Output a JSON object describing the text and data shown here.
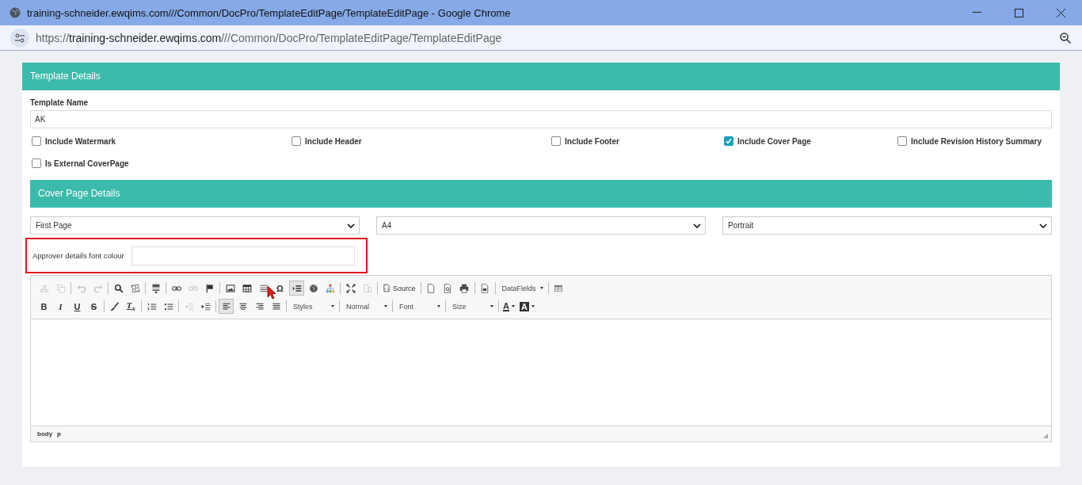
{
  "window": {
    "title": "training-schneider.ewqims.com///Common/DocPro/TemplateEditPage/TemplateEditPage - Google Chrome"
  },
  "address_bar": {
    "scheme": "https://",
    "host": "training-schneider.ewqims.com",
    "path": "///Common/DocPro/TemplateEditPage/TemplateEditPage"
  },
  "template_details": {
    "title": "Template Details",
    "name_label": "Template Name",
    "name_value": "AK",
    "options": [
      {
        "label": "Include Watermark",
        "checked": false
      },
      {
        "label": "Include Header",
        "checked": false
      },
      {
        "label": "Include Footer",
        "checked": false
      },
      {
        "label": "Include Cover Page",
        "checked": true
      },
      {
        "label": "Include Revision History Summary",
        "checked": false
      },
      {
        "label": "Is External CoverPage",
        "checked": false
      }
    ]
  },
  "cover_page_details": {
    "title": "Cover Page Details",
    "dropdowns": [
      {
        "value": "First Page"
      },
      {
        "value": "A4"
      },
      {
        "value": "Portrait"
      }
    ],
    "approver_label": "Approver details font colour"
  },
  "editor": {
    "toolbar_rows": [
      [
        {
          "kind": "icon",
          "disabled": true,
          "active": false
        },
        {
          "kind": "icon",
          "disabled": true,
          "active": false
        },
        {
          "kind": "sep"
        },
        {
          "kind": "icon",
          "disabled": true,
          "active": false
        },
        {
          "kind": "icon",
          "disabled": true,
          "active": false
        },
        {
          "kind": "sep"
        },
        {
          "kind": "icon",
          "disabled": false,
          "active": false
        },
        {
          "kind": "icon",
          "disabled": false,
          "active": false
        },
        {
          "kind": "sep"
        },
        {
          "kind": "icon",
          "disabled": false,
          "active": false
        },
        {
          "kind": "sep"
        },
        {
          "kind": "icon",
          "disabled": false,
          "active": false
        },
        {
          "kind": "icon",
          "disabled": true,
          "active": false
        },
        {
          "kind": "icon",
          "disabled": false,
          "active": false
        },
        {
          "kind": "sep"
        },
        {
          "kind": "icon",
          "disabled": false,
          "active": false
        },
        {
          "kind": "icon",
          "disabled": false,
          "active": false
        },
        {
          "kind": "icon",
          "disabled": false,
          "active": false
        },
        {
          "kind": "glyph",
          "text": "Ω",
          "disabled": false,
          "active": false
        },
        {
          "kind": "icon",
          "disabled": false,
          "active": true
        },
        {
          "kind": "icon",
          "disabled": false,
          "active": false
        },
        {
          "kind": "icon",
          "disabled": false,
          "active": false
        },
        {
          "kind": "sep"
        },
        {
          "kind": "icon",
          "disabled": false,
          "active": false
        },
        {
          "kind": "icon",
          "disabled": true,
          "active": false
        },
        {
          "kind": "sep"
        },
        {
          "kind": "source",
          "text": "Source",
          "disabled": false,
          "active": false
        },
        {
          "kind": "sep"
        },
        {
          "kind": "icon",
          "disabled": false,
          "active": false
        },
        {
          "kind": "icon",
          "disabled": false,
          "active": false
        },
        {
          "kind": "icon",
          "disabled": false,
          "active": false
        },
        {
          "kind": "sep"
        },
        {
          "kind": "icon",
          "disabled": false,
          "active": false
        },
        {
          "kind": "sep"
        },
        {
          "kind": "combo",
          "text": "DataFields"
        },
        {
          "kind": "sep"
        },
        {
          "kind": "icon",
          "disabled": false,
          "active": false
        }
      ],
      [
        {
          "kind": "glyph",
          "text": "B",
          "disabled": false,
          "active": false
        },
        {
          "kind": "glyph",
          "text": "I",
          "disabled": false,
          "active": false
        },
        {
          "kind": "glyph",
          "text": "U",
          "disabled": false,
          "active": false
        },
        {
          "kind": "glyph",
          "text": "S",
          "disabled": false,
          "active": false
        },
        {
          "kind": "sep"
        },
        {
          "kind": "icon",
          "disabled": false,
          "active": false
        },
        {
          "kind": "glyph",
          "text": "T$_{x}$",
          "disabled": false,
          "active": false
        },
        {
          "kind": "sep"
        },
        {
          "kind": "icon",
          "disabled": false,
          "active": false
        },
        {
          "kind": "icon",
          "disabled": false,
          "active": false
        },
        {
          "kind": "sep"
        },
        {
          "kind": "icon",
          "disabled": true,
          "active": false
        },
        {
          "kind": "icon",
          "disabled": false,
          "active": false
        },
        {
          "kind": "sep"
        },
        {
          "kind": "icon",
          "disabled": false,
          "active": true
        },
        {
          "kind": "icon",
          "disabled": false,
          "active": false
        },
        {
          "kind": "icon",
          "disabled": false,
          "active": false
        },
        {
          "kind": "icon",
          "disabled": false,
          "active": false
        },
        {
          "kind": "sep"
        },
        {
          "kind": "combo",
          "text": "Styles"
        },
        {
          "kind": "sep"
        },
        {
          "kind": "combo",
          "text": "Normal"
        },
        {
          "kind": "sep"
        },
        {
          "kind": "combo",
          "text": "Font"
        },
        {
          "kind": "sep"
        },
        {
          "kind": "combo",
          "text": "Size"
        },
        {
          "kind": "sep"
        },
        {
          "kind": "color",
          "text": "A",
          "disabled": false,
          "active": false
        },
        {
          "kind": "bgcolor",
          "text": "A",
          "disabled": false,
          "active": false
        }
      ]
    ],
    "path": [
      "body",
      "p"
    ]
  }
}
